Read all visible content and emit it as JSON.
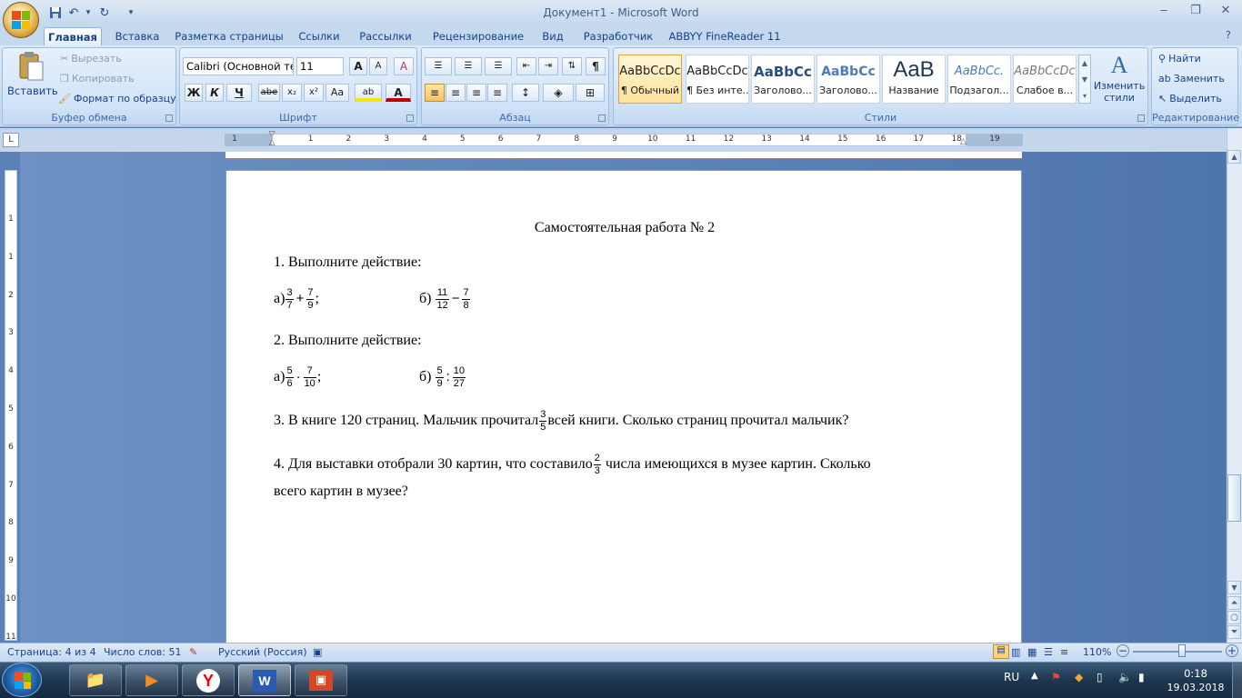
{
  "window": {
    "title": "Документ1 - Microsoft Word",
    "minimize": "‒",
    "restore": "❐",
    "close": "✕",
    "help": "?"
  },
  "quick_access": {
    "save_icon": "save-icon",
    "undo": "↶",
    "redo": "↻",
    "customize": "▾"
  },
  "tabs": [
    "Главная",
    "Вставка",
    "Разметка страницы",
    "Ссылки",
    "Рассылки",
    "Рецензирование",
    "Вид",
    "Разработчик",
    "ABBYY FineReader 11"
  ],
  "clipboard": {
    "paste": "Вставить",
    "cut": "Вырезать",
    "copy": "Копировать",
    "format_painter": "Формат по образцу",
    "label": "Буфер обмена"
  },
  "font": {
    "name": "Calibri (Основной те",
    "size": "11",
    "grow": "A",
    "shrink": "A",
    "clear": "A",
    "bold": "Ж",
    "italic": "К",
    "underline": "Ч",
    "strike": "abe",
    "subscript": "x₂",
    "superscript": "x²",
    "case": "Aa",
    "highlight": "ab",
    "color": "A",
    "label": "Шрифт"
  },
  "paragraph": {
    "pilcrow": "¶",
    "label": "Абзац"
  },
  "styles": {
    "items": [
      {
        "preview": "AaBbCcDc",
        "name": "¶ Обычный"
      },
      {
        "preview": "AaBbCcDc",
        "name": "¶ Без инте..."
      },
      {
        "preview": "AaBbCc",
        "name": "Заголово..."
      },
      {
        "preview": "AaBbCc",
        "name": "Заголово..."
      },
      {
        "preview": "AaB",
        "name": "Название"
      },
      {
        "preview": "AaBbCc.",
        "name": "Подзагол..."
      },
      {
        "preview": "AaBbCcDc",
        "name": "Слабое в..."
      }
    ],
    "change": "Изменить стили",
    "label": "Стили"
  },
  "editing": {
    "find": "Найти",
    "replace": "Заменить",
    "select": "Выделить",
    "label": "Редактирование"
  },
  "ruler": {
    "corner": "L",
    "h_numbers": [
      "1",
      "·",
      "1",
      "2",
      "3",
      "4",
      "5",
      "6",
      "7",
      "8",
      "9",
      "10",
      "11",
      "12",
      "13",
      "14",
      "15",
      "16",
      "17",
      "18",
      "19"
    ],
    "v_numbers": [
      "1",
      "1",
      "2",
      "3",
      "4",
      "5",
      "6",
      "7",
      "8",
      "9",
      "10",
      "11"
    ]
  },
  "document": {
    "title": "Самостоятельная работа № 2",
    "q1": "1. Выполните действие:",
    "q1a_label": "а)",
    "q1a": {
      "n1": "3",
      "d1": "7",
      "op": "+",
      "n2": "7",
      "d2": "9",
      "end": ";"
    },
    "q1b_label": "б)",
    "q1b": {
      "n1": "11",
      "d1": "12",
      "op": "−",
      "n2": "7",
      "d2": "8"
    },
    "q2": "2. Выполните действие:",
    "q2a_label": "а)",
    "q2a": {
      "n1": "5",
      "d1": "6",
      "op": "·",
      "n2": "7",
      "d2": "10",
      "end": ";"
    },
    "q2b_label": "б)",
    "q2b": {
      "n1": "5",
      "d1": "9",
      "op": ":",
      "n2": "10",
      "d2": "27"
    },
    "q3_before": "3. В книге 120 страниц. Мальчик прочитал",
    "q3_frac": {
      "n": "3",
      "d": "5"
    },
    "q3_after": "всей книги. Сколько страниц прочитал мальчик?",
    "q4_before": "4.  Для выставки отобрали 30 картин, что составило",
    "q4_frac": {
      "n": "2",
      "d": "3"
    },
    "q4_after": " числа имеющихся в  музее картин. Сколько",
    "q4_line2": "всего картин в музее?"
  },
  "status": {
    "page": "Страница: 4 из 4",
    "words": "Число слов: 51",
    "language": "Русский (Россия)",
    "zoom": "110%",
    "zoom_level": 0.55
  },
  "taskbar": {
    "lang": "RU",
    "time": "0:18",
    "date": "19.03.2018"
  }
}
